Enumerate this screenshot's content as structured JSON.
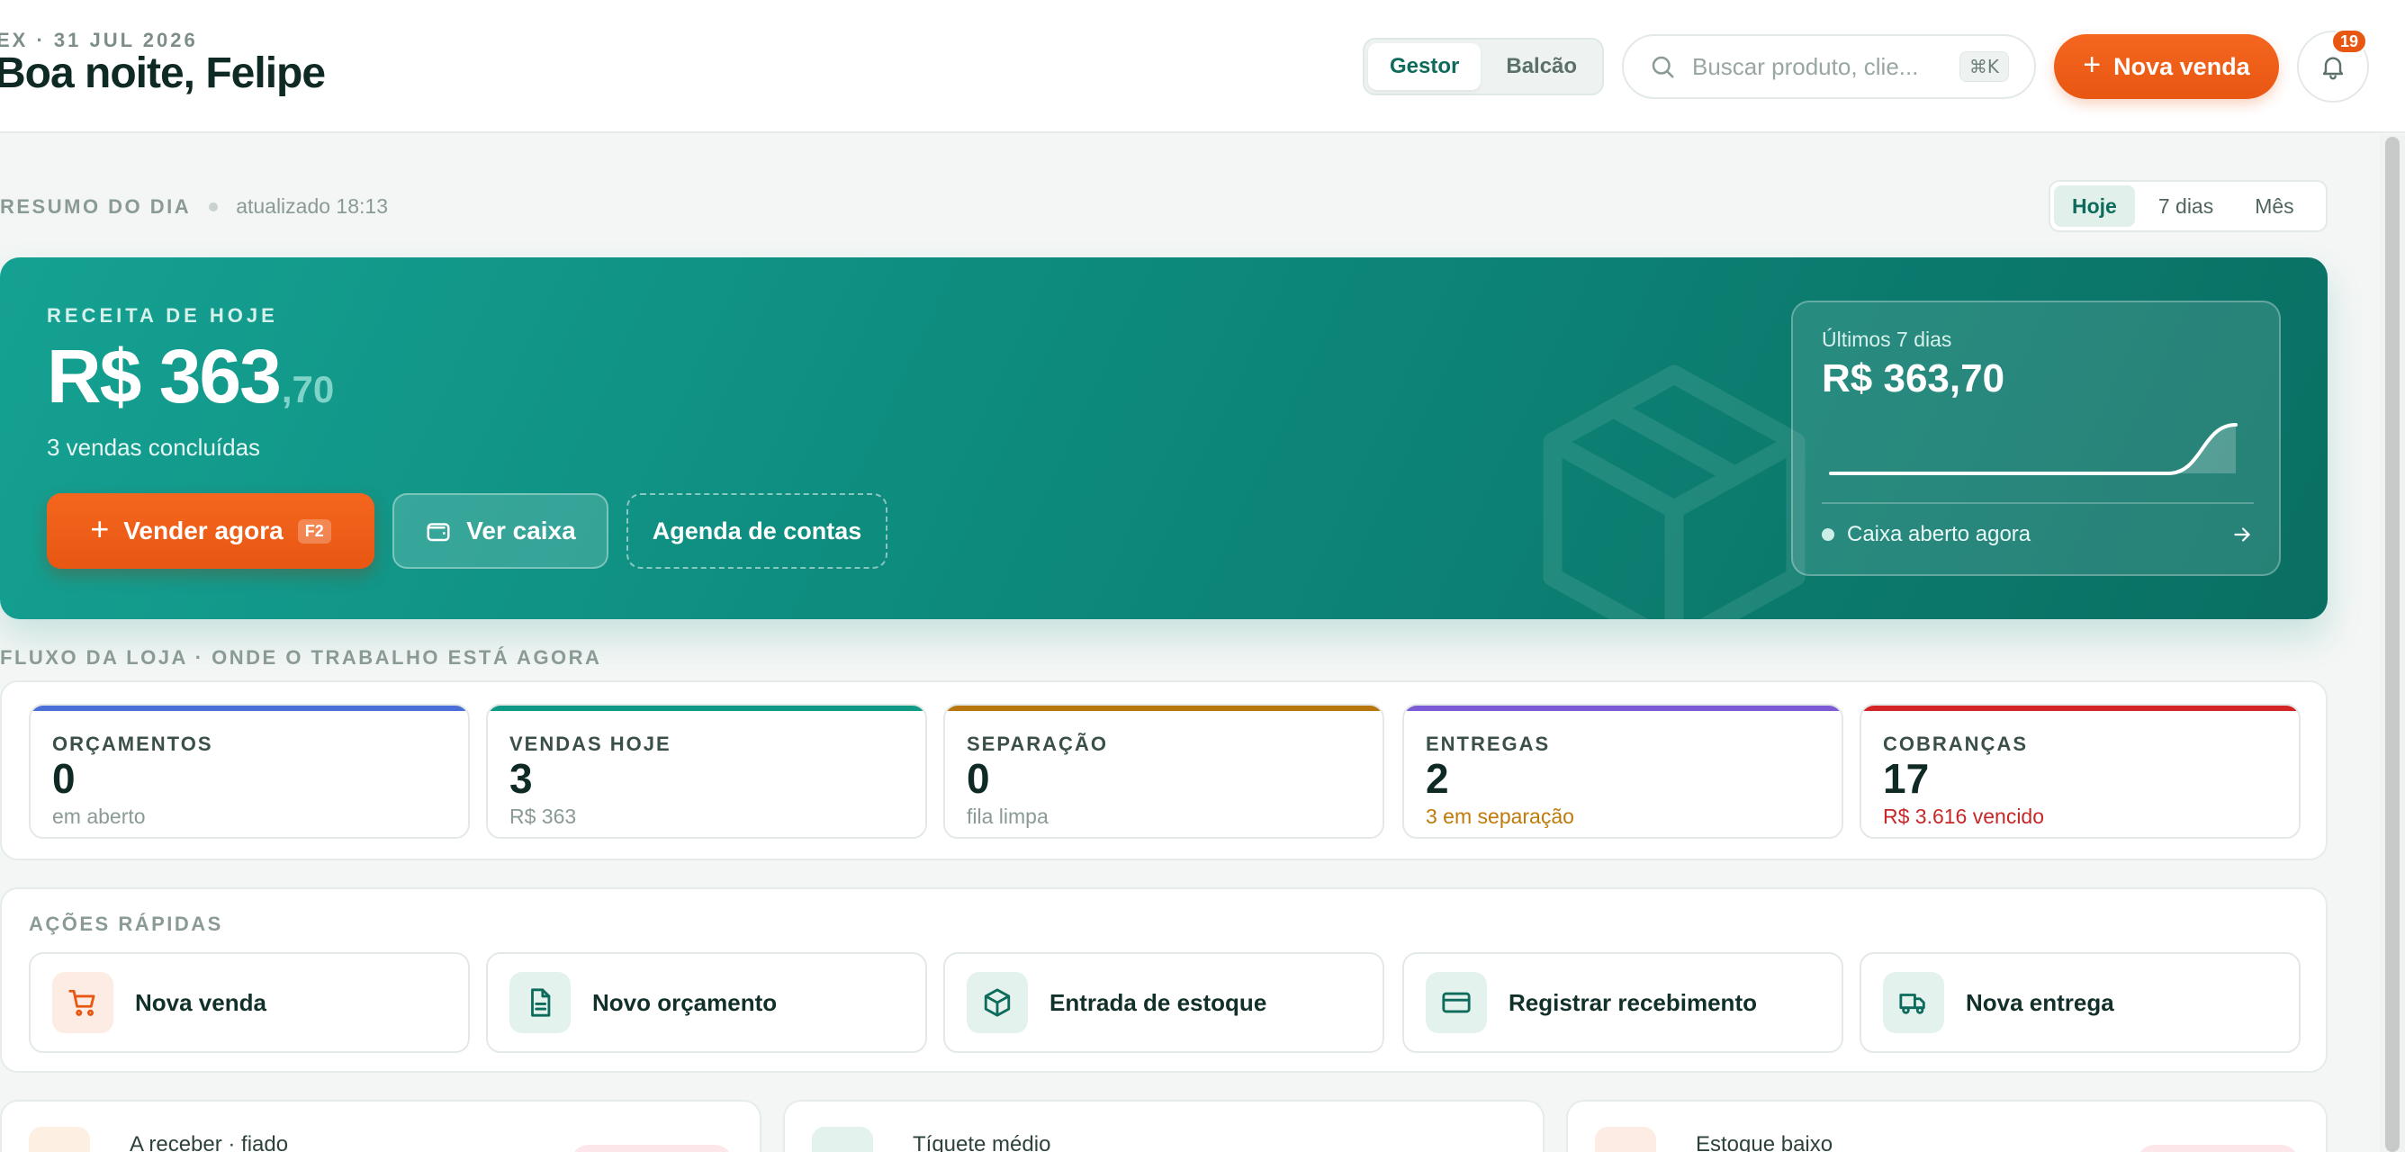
{
  "header": {
    "eyebrow": "EX · 31 JUL 2026",
    "greeting": "Boa noite, Felipe",
    "modes": [
      "Gestor",
      "Balcão"
    ],
    "active_mode": "Gestor",
    "search_placeholder": "Buscar produto, clie...",
    "search_shortcut": "⌘K",
    "new_sale_label": "Nova venda",
    "notifications_count": "19"
  },
  "summary": {
    "label": "RESUMO DO DIA",
    "updated": "atualizado 18:13",
    "ranges": [
      "Hoje",
      "7 dias",
      "Mês"
    ],
    "active_range": "Hoje"
  },
  "hero": {
    "eyebrow": "RECEITA DE HOJE",
    "amount_int": "R$ 363",
    "amount_cents": ",70",
    "sub": "3 vendas concluídas",
    "sell_label": "Vender agora",
    "sell_shortcut": "F2",
    "cash_label": "Ver caixa",
    "agenda_label": "Agenda de contas",
    "spark": {
      "label": "Últimos 7 dias",
      "value": "R$ 363,70",
      "status": "Caixa aberto agora",
      "points": [
        0,
        0,
        0,
        0,
        0,
        0,
        363.7
      ]
    }
  },
  "flow": {
    "label": "FLUXO DA LOJA · ONDE O TRABALHO ESTÁ AGORA",
    "cards": [
      {
        "title": "ORÇAMENTOS",
        "value": "0",
        "sub": "em aberto",
        "color": "#4a6fd6",
        "sub_color": "#8a9a95"
      },
      {
        "title": "VENDAS HOJE",
        "value": "3",
        "sub": "R$ 363",
        "color": "#0f9a86",
        "sub_color": "#8a9a95"
      },
      {
        "title": "SEPARAÇÃO",
        "value": "0",
        "sub": "fila limpa",
        "color": "#b8760f",
        "sub_color": "#8a9a95"
      },
      {
        "title": "ENTREGAS",
        "value": "2",
        "sub": "3 em separação",
        "color": "#7c5bd6",
        "sub_color": "#c07a0a"
      },
      {
        "title": "COBRANÇAS",
        "value": "17",
        "sub": "R$ 3.616 vencido",
        "color": "#d32525",
        "sub_color": "#c62828"
      }
    ]
  },
  "quick_actions": {
    "label": "AÇÕES RÁPIDAS",
    "items": [
      {
        "label": "Nova venda",
        "icon": "cart-icon",
        "bg": "#fdece4",
        "fg": "#e85712"
      },
      {
        "label": "Novo orçamento",
        "icon": "document-icon",
        "bg": "#e4f2ee",
        "fg": "#0d6b5c"
      },
      {
        "label": "Entrada de estoque",
        "icon": "box-icon",
        "bg": "#e4f2ee",
        "fg": "#0d6b5c"
      },
      {
        "label": "Registrar recebimento",
        "icon": "card-icon",
        "bg": "#e4f2ee",
        "fg": "#0d6b5c"
      },
      {
        "label": "Nova entrega",
        "icon": "truck-icon",
        "bg": "#e4f2ee",
        "fg": "#0d6b5c"
      }
    ]
  },
  "bottom_cards": [
    {
      "title": "A receber · fiado",
      "bg": "#fdf0e2",
      "pill": "#fde6ea"
    },
    {
      "title": "Tíquete médio",
      "bg": "#e4f2ee",
      "pill": ""
    },
    {
      "title": "Estoque baixo",
      "bg": "#fdece4",
      "pill": "#fde6ea"
    }
  ]
}
